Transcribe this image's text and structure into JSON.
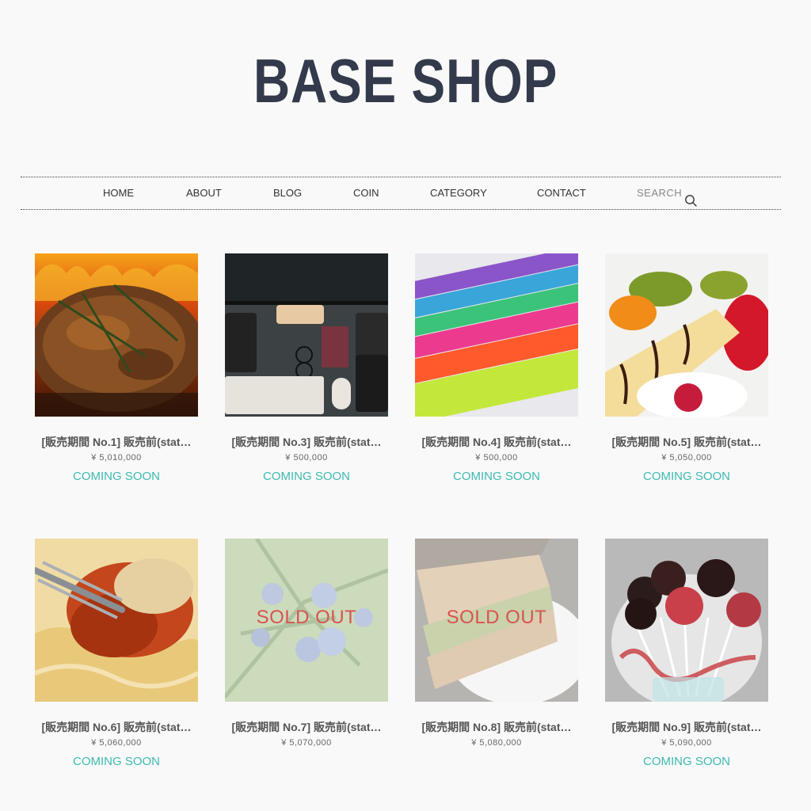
{
  "shop": {
    "title": "BASE SHOP"
  },
  "nav": {
    "items": [
      "HOME",
      "ABOUT",
      "BLOG",
      "COIN",
      "CATEGORY",
      "CONTACT"
    ],
    "search_label": "SEARCH",
    "search_icon": "search-icon"
  },
  "colors": {
    "logo": "#333a4b",
    "status": "#3dbab0",
    "soldout": "#d9534f",
    "background": "#f9f9f9"
  },
  "products": [
    {
      "title": "[販売期間 No.1] 販売前(stat…",
      "price": "¥ 5,010,000",
      "status": "COMING SOON",
      "sold_out": false
    },
    {
      "title": "[販売期間 No.3] 販売前(stat…",
      "price": "¥ 500,000",
      "status": "COMING SOON",
      "sold_out": false
    },
    {
      "title": "[販売期間 No.4] 販売前(stat…",
      "price": "¥ 500,000",
      "status": "COMING SOON",
      "sold_out": false
    },
    {
      "title": "[販売期間 No.5] 販売前(stat…",
      "price": "¥ 5,050,000",
      "status": "COMING SOON",
      "sold_out": false
    },
    {
      "title": "[販売期間 No.6] 販売前(stat…",
      "price": "¥ 5,060,000",
      "status": "COMING SOON",
      "sold_out": false
    },
    {
      "title": "[販売期間 No.7] 販売前(stat…",
      "price": "¥ 5,070,000",
      "status": "",
      "sold_out": true,
      "sold_out_label": "SOLD OUT"
    },
    {
      "title": "[販売期間 No.8] 販売前(stat…",
      "price": "¥ 5,080,000",
      "status": "",
      "sold_out": true,
      "sold_out_label": "SOLD OUT"
    },
    {
      "title": "[販売期間 No.9] 販売前(stat…",
      "price": "¥ 5,090,000",
      "status": "COMING SOON",
      "sold_out": false
    }
  ]
}
